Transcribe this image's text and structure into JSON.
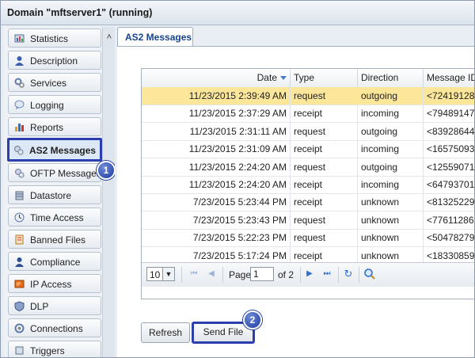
{
  "window": {
    "title": "Domain \"mftserver1\" (running)"
  },
  "sidebar": {
    "items": [
      {
        "label": "Statistics",
        "icon": "statistics-icon"
      },
      {
        "label": "Description",
        "icon": "person-icon"
      },
      {
        "label": "Services",
        "icon": "gears-icon"
      },
      {
        "label": "Logging",
        "icon": "log-bubble-icon"
      },
      {
        "label": "Reports",
        "icon": "bar-chart-icon"
      },
      {
        "label": "AS2 Messages",
        "icon": "as2-messages-icon"
      },
      {
        "label": "OFTP Messages",
        "icon": "oftp-messages-icon"
      },
      {
        "label": "Datastore",
        "icon": "database-icon"
      },
      {
        "label": "Time Access",
        "icon": "clock-icon"
      },
      {
        "label": "Banned Files",
        "icon": "banned-files-icon"
      },
      {
        "label": "Compliance",
        "icon": "compliance-icon"
      },
      {
        "label": "IP Access",
        "icon": "ip-access-icon"
      },
      {
        "label": "DLP",
        "icon": "shield-icon"
      },
      {
        "label": "Connections",
        "icon": "connections-icon"
      },
      {
        "label": "Triggers",
        "icon": "triggers-icon"
      }
    ],
    "active_index": 5
  },
  "callouts": {
    "one": "1",
    "two": "2"
  },
  "tab": {
    "label": "AS2 Messages"
  },
  "table": {
    "columns": [
      "Date",
      "Type",
      "Direction",
      "Message ID"
    ],
    "rows": [
      [
        "11/23/2015 2:39:49 AM",
        "request",
        "outgoing",
        "<72419128"
      ],
      [
        "11/23/2015 2:37:29 AM",
        "receipt",
        "incoming",
        "<79489147"
      ],
      [
        "11/23/2015 2:31:11 AM",
        "request",
        "outgoing",
        "<83928644"
      ],
      [
        "11/23/2015 2:31:09 AM",
        "receipt",
        "incoming",
        "<16575093"
      ],
      [
        "11/23/2015 2:24:20 AM",
        "request",
        "outgoing",
        "<12559071"
      ],
      [
        "11/23/2015 2:24:20 AM",
        "receipt",
        "incoming",
        "<64793701"
      ],
      [
        "7/23/2015 5:23:44 PM",
        "receipt",
        "unknown",
        "<81325229"
      ],
      [
        "7/23/2015 5:23:43 PM",
        "request",
        "unknown",
        "<77611286"
      ],
      [
        "7/23/2015 5:22:23 PM",
        "request",
        "unknown",
        "<50478279"
      ],
      [
        "7/23/2015 5:17:24 PM",
        "receipt",
        "unknown",
        "<18330859"
      ]
    ],
    "selected_row": 0
  },
  "pager": {
    "page_size": "10",
    "page_label": "Page",
    "page_value": "1",
    "of_label": "of 2"
  },
  "buttons": {
    "refresh": "Refresh",
    "send_file": "Send File"
  },
  "colors": {
    "highlight": "#2b3fae",
    "selected_row": "#fbe69a",
    "tab_text": "#15428b"
  }
}
